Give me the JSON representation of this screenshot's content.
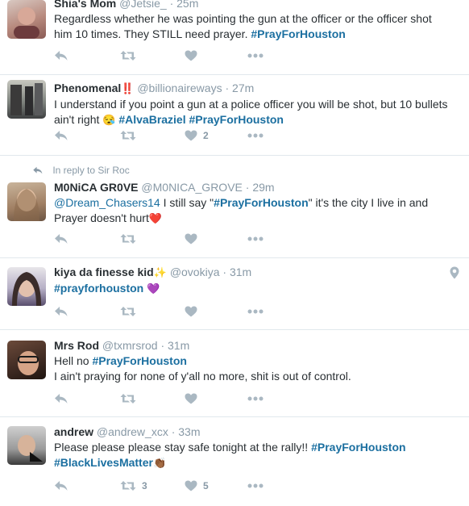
{
  "tweets": [
    {
      "name": "Shia's Mom",
      "handle": "@Jetsie_",
      "time": "· 25m",
      "line1_a": "Regardless whether he was pointing the gun at the officer or the officer shot",
      "line2_a": "him 10 times. They STILL need prayer. ",
      "line2_tag": "#PrayForHouston",
      "likes": ""
    },
    {
      "name": "Phenomenal",
      "name_emoji": "‼️",
      "handle": "@billionaireways",
      "time": "· 27m",
      "line1_a": "I understand if you point a gun at a police officer you will be shot, but 10 bullets",
      "line2_a": "ain't right ",
      "line2_emoji": "😪",
      "line2_tag1": "#AlvaBraziel",
      "line2_tag2": "#PrayForHouston",
      "likes": "2"
    },
    {
      "reply_label": "In reply to Sir Roc",
      "name": "M0NiCA GR0VE",
      "handle": "@M0NICA_GROVE",
      "time": "· 29m",
      "line1_mention": "@Dream_Chasers14",
      "line1_a": " I still say \"",
      "line1_tag": "#PrayForHouston",
      "line1_b": "\" it's the city I live in and",
      "line2_a": "Prayer doesn't hurt",
      "line2_emoji": "❤️",
      "likes": ""
    },
    {
      "name": "kiya da finesse kid",
      "name_emoji": "✨",
      "handle": "@ovokiya",
      "time": "· 31m",
      "line1_tag": "#prayforhouston",
      "line1_emoji": "💜",
      "likes": ""
    },
    {
      "name": "Mrs Rod",
      "handle": "@txmrsrod",
      "time": "· 31m",
      "line1_a": "Hell no ",
      "line1_tag": "#PrayForHouston",
      "line2_a": "I ain't praying for none of y'all no more, shit is out of control.",
      "likes": ""
    },
    {
      "name": "andrew",
      "handle": "@andrew_xcx",
      "time": "· 33m",
      "line1_a": "Please please please stay safe tonight at the rally!! ",
      "line1_tag": "#PrayForHouston",
      "line2_tag": "#BlackLivesMatter",
      "line2_emoji": "👏🏾",
      "retweets": "3",
      "likes": "5"
    }
  ],
  "icons": [
    "reply-icon",
    "retweet-icon",
    "like-icon",
    "more-icon",
    "location-pin-icon",
    "in-reply-arrow-icon"
  ],
  "colors": {
    "hashtag": "#1b6fa0",
    "muted": "#8899a6",
    "icon": "#aab8c2",
    "divider": "#e1e8ed"
  }
}
